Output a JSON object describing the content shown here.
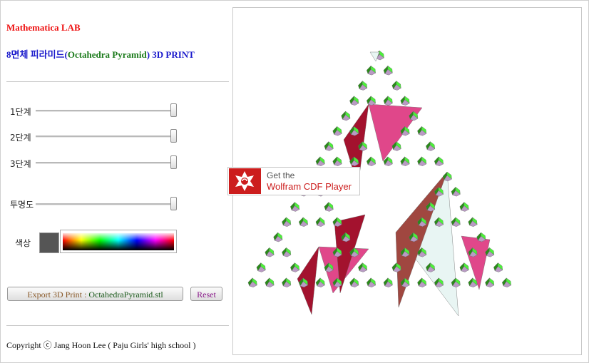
{
  "header": {
    "title": "Mathematica LAB",
    "subtitle_part1": "8면체 피라미드(",
    "subtitle_part2": "Octahedra Pyramid",
    "subtitle_part3": ") 3D PRINT"
  },
  "controls": {
    "sliders": [
      {
        "label": "1단계",
        "value": 1.0
      },
      {
        "label": "2단계",
        "value": 1.0
      },
      {
        "label": "3단계",
        "value": 1.0
      },
      {
        "label": "투명도",
        "value": 1.0
      }
    ],
    "color_label": "색상",
    "color_value": "#555555"
  },
  "buttons": {
    "export_prefix": "Export 3D Print : ",
    "export_file": "OctahedraPyramid.stl",
    "reset": "Reset"
  },
  "footer": {
    "copyright": "Copyright ⓒ Jang Hoon Lee ( Paju Girls' high school )"
  },
  "cdf_banner": {
    "line1": "Get the",
    "line2": "Wolfram CDF Player"
  },
  "colors": {
    "title": "#ee1111",
    "subtitle_blue": "#1a1acc",
    "subtitle_green": "#1a7a1a",
    "export_brown": "#8a5a2a",
    "reset_purple": "#8a1a8a",
    "green_face": "#4cf03a",
    "dark_green_face": "#2a8a1a",
    "pink_face": "#e0478a",
    "crimson_face": "#a3122e",
    "lilac_face": "#b99ac4",
    "pale_face": "#e8f5f3",
    "brown_face": "#a04740"
  }
}
